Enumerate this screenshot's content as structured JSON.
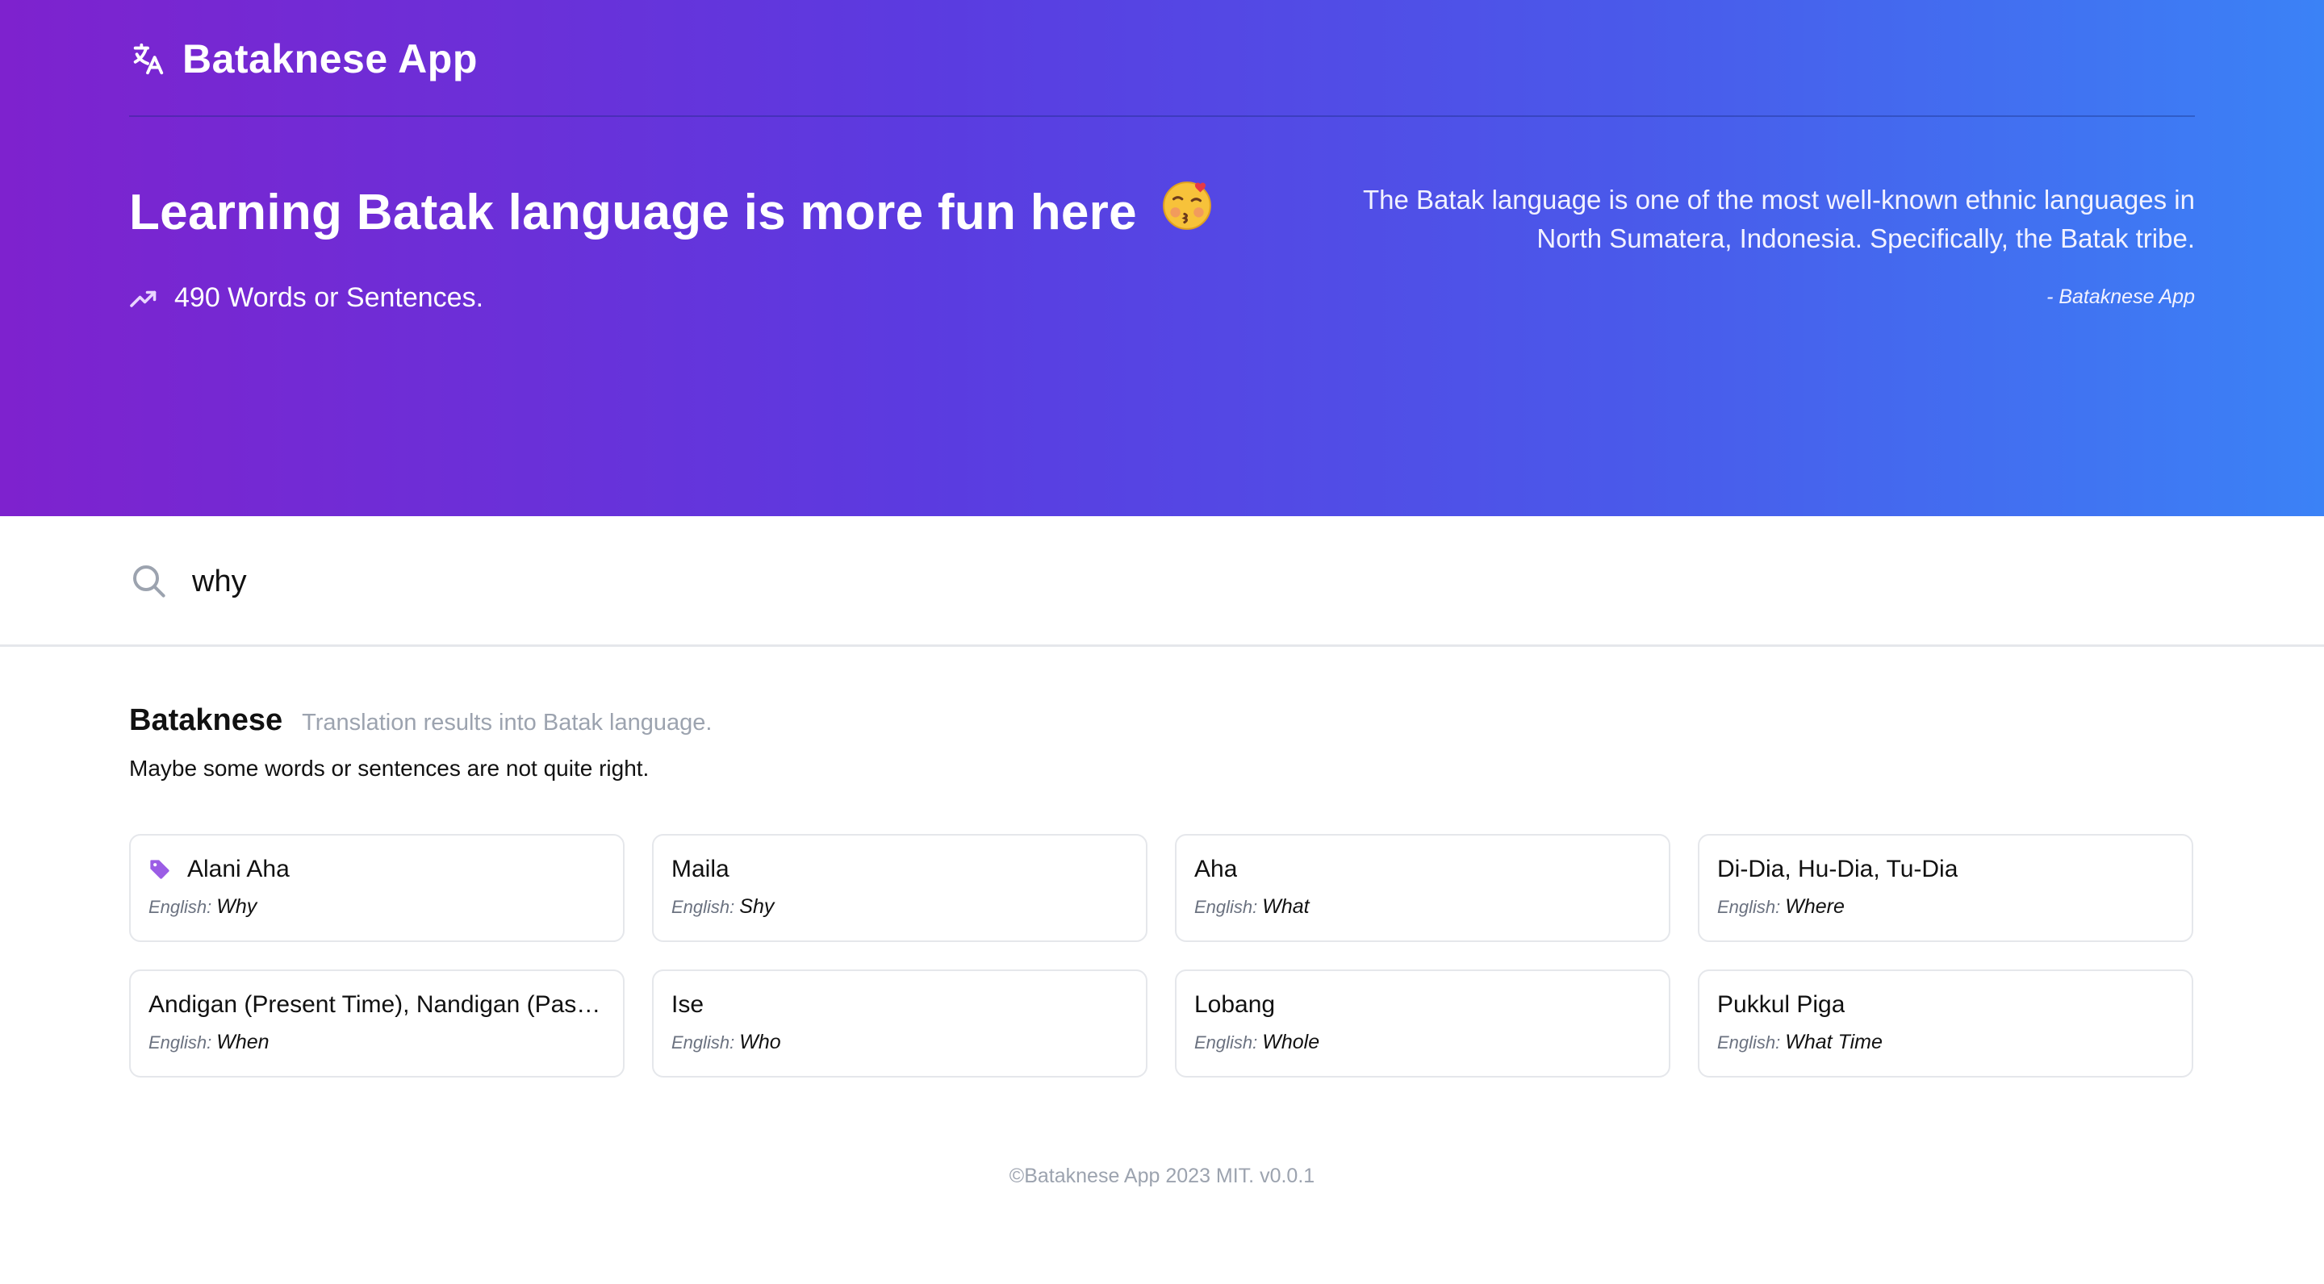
{
  "app": {
    "name": "Bataknese App",
    "logo_icon": "translate-icon"
  },
  "hero": {
    "title": "Learning Batak language is more fun here",
    "emoji": "kissing-face-emoji",
    "stat_icon": "trending-up-icon",
    "stat_text": "490 Words or Sentences.",
    "quote": "The Batak language is one of the most well-known ethnic languages in North Sumatera, Indonesia. Specifically, the Batak tribe.",
    "quote_author": "- Bataknese App",
    "gradient": [
      "#7e22ce",
      "#3b82f6"
    ]
  },
  "search": {
    "icon": "search-icon",
    "value": "why"
  },
  "results": {
    "title": "Bataknese",
    "subtitle": "Translation results into Batak language.",
    "note": "Maybe some words or sentences are not quite right.",
    "english_label": "English:",
    "tag_color": "#9b5de5",
    "items": [
      {
        "batak": "Alani Aha",
        "english": "Why",
        "tagged": true
      },
      {
        "batak": "Maila",
        "english": "Shy"
      },
      {
        "batak": "Aha",
        "english": "What"
      },
      {
        "batak": "Di-Dia, Hu-Dia, Tu-Dia",
        "english": "Where"
      },
      {
        "batak": "Andigan (Present Time), Nandigan (Past Time)",
        "english": "When"
      },
      {
        "batak": "Ise",
        "english": "Who"
      },
      {
        "batak": "Lobang",
        "english": "Whole"
      },
      {
        "batak": "Pukkul Piga",
        "english": "What Time"
      }
    ]
  },
  "footer": {
    "text": "©Bataknese App 2023 MIT. v0.0.1"
  }
}
